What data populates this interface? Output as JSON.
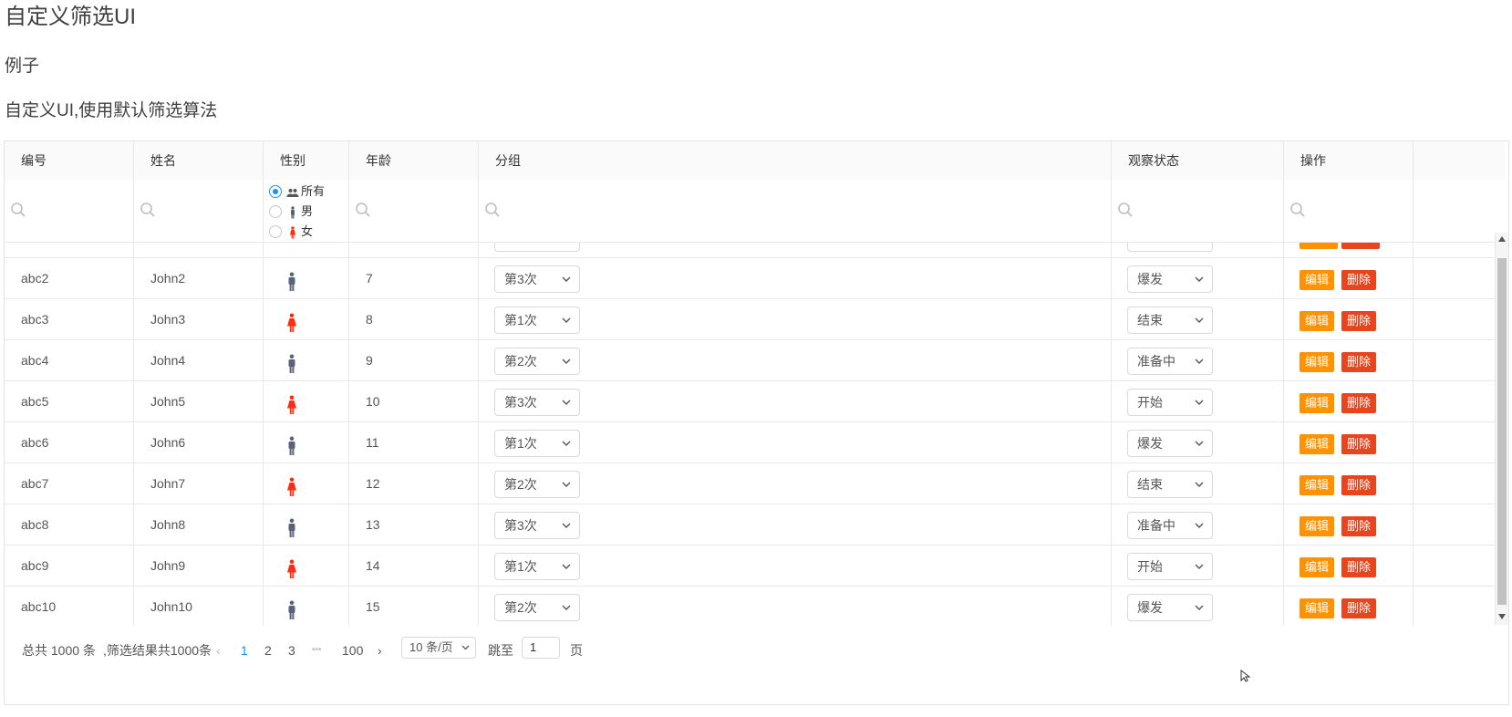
{
  "page": {
    "title": "自定义筛选UI",
    "section": "例子",
    "subsection": "自定义UI,使用默认筛选算法"
  },
  "table": {
    "columns": [
      "编号",
      "姓名",
      "性别",
      "年龄",
      "分组",
      "观察状态",
      "操作"
    ],
    "gender_filter": {
      "options": [
        "所有",
        "男",
        "女"
      ],
      "selected": "所有"
    },
    "rows": [
      {
        "id": "abc2",
        "name": "John2",
        "gender": "male",
        "age": "7",
        "group": "第3次",
        "status": "爆发"
      },
      {
        "id": "abc3",
        "name": "John3",
        "gender": "female",
        "age": "8",
        "group": "第1次",
        "status": "结束"
      },
      {
        "id": "abc4",
        "name": "John4",
        "gender": "male",
        "age": "9",
        "group": "第2次",
        "status": "准备中"
      },
      {
        "id": "abc5",
        "name": "John5",
        "gender": "female",
        "age": "10",
        "group": "第3次",
        "status": "开始"
      },
      {
        "id": "abc6",
        "name": "John6",
        "gender": "male",
        "age": "11",
        "group": "第1次",
        "status": "爆发"
      },
      {
        "id": "abc7",
        "name": "John7",
        "gender": "female",
        "age": "12",
        "group": "第2次",
        "status": "结束"
      },
      {
        "id": "abc8",
        "name": "John8",
        "gender": "male",
        "age": "13",
        "group": "第3次",
        "status": "准备中"
      },
      {
        "id": "abc9",
        "name": "John9",
        "gender": "female",
        "age": "14",
        "group": "第1次",
        "status": "开始"
      },
      {
        "id": "abc10",
        "name": "John10",
        "gender": "male",
        "age": "15",
        "group": "第2次",
        "status": "爆发"
      }
    ],
    "edit_label": "编辑",
    "delete_label": "删除"
  },
  "pagination": {
    "total": "总共 1000 条",
    "filtered": ",筛选结果共1000条",
    "pages": [
      "1",
      "2",
      "3"
    ],
    "ellipsis": "•••",
    "last_page": "100",
    "active_page": "1",
    "page_size": "10 条/页",
    "jump_label": "跳至",
    "jump_value": "1",
    "page_suffix": "页"
  },
  "colors": {
    "edit": "#ff9200",
    "delete": "#e8451e",
    "male": "#5a6278",
    "female": "#ff2d0f",
    "active": "#1890ff"
  }
}
